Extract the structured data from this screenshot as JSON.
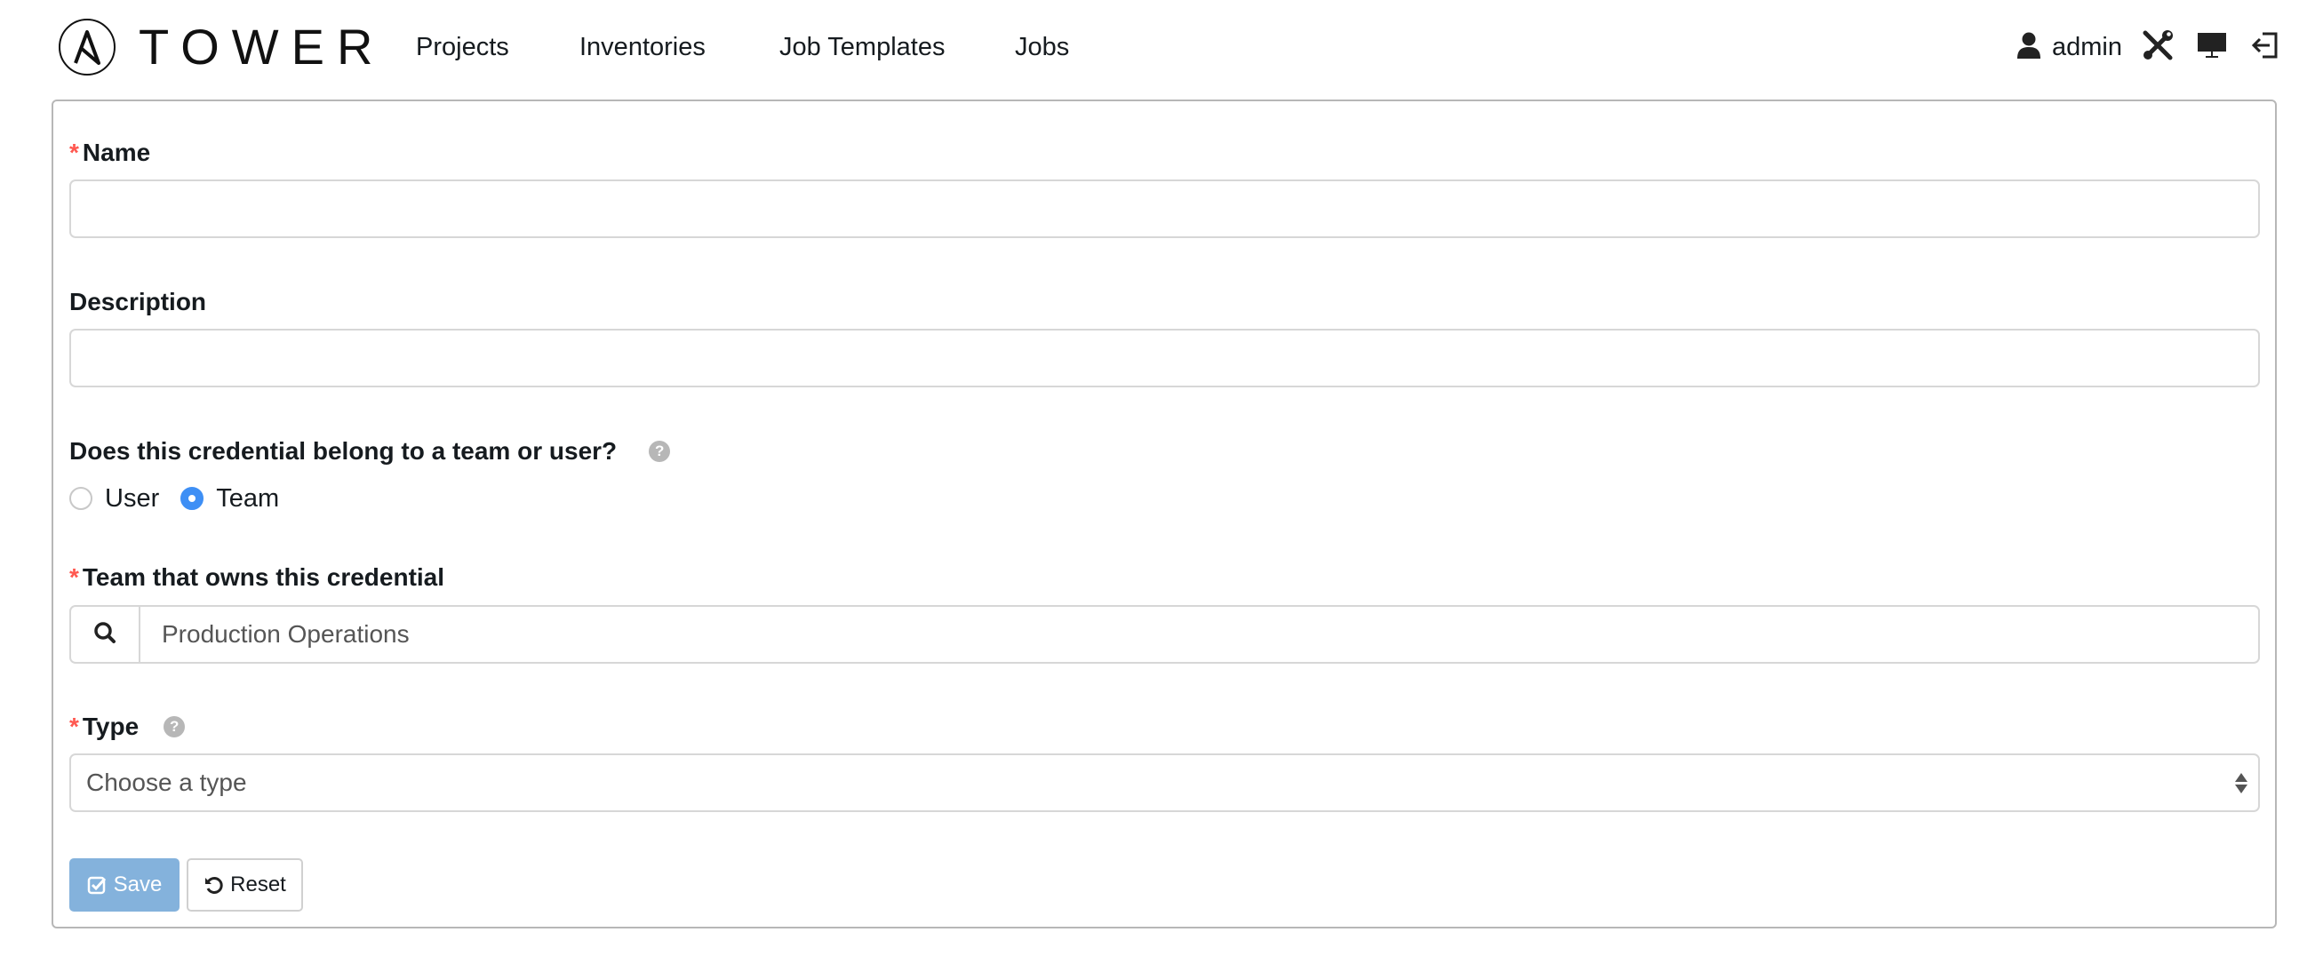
{
  "header": {
    "brand": "TOWER",
    "nav": [
      {
        "label": "Projects"
      },
      {
        "label": "Inventories"
      },
      {
        "label": "Job Templates"
      },
      {
        "label": "Jobs"
      }
    ],
    "user": {
      "name": "admin",
      "icon": "user-icon"
    },
    "tools": [
      {
        "icon": "settings-wrench-icon"
      },
      {
        "icon": "monitor-icon"
      },
      {
        "icon": "logout-icon"
      }
    ]
  },
  "form": {
    "name": {
      "label": "Name",
      "required": true,
      "value": ""
    },
    "description": {
      "label": "Description",
      "required": false,
      "value": ""
    },
    "owner_question": {
      "label": "Does this credential belong to a team or user?",
      "options": [
        {
          "label": "User",
          "checked": false
        },
        {
          "label": "Team",
          "checked": true
        }
      ]
    },
    "team": {
      "label": "Team that owns this credential",
      "required": true,
      "value": "Production Operations"
    },
    "type": {
      "label": "Type",
      "required": true,
      "selected": "Choose a type"
    },
    "buttons": {
      "save": "Save",
      "reset": "Reset"
    }
  },
  "colors": {
    "required": "#ff5850",
    "radio_checked": "#3e8ff5",
    "save_button": "#84b2dc"
  }
}
